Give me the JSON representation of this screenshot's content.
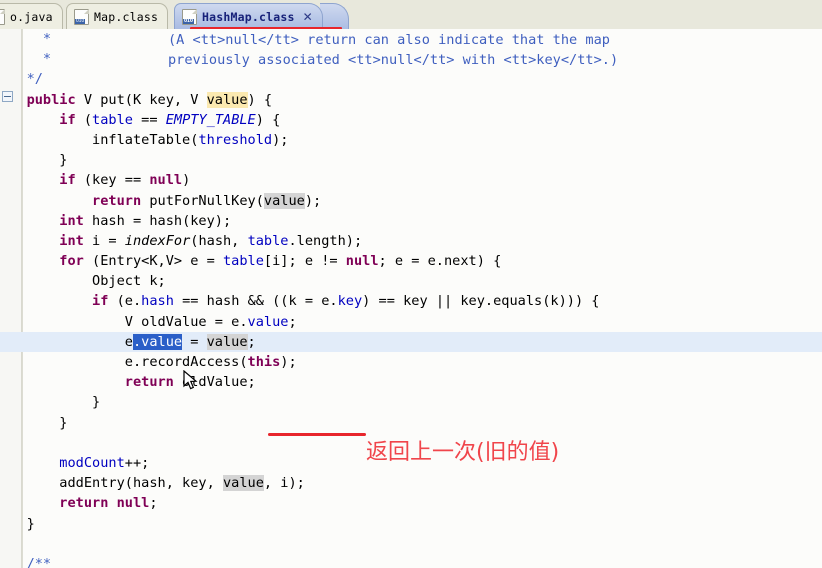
{
  "window": {
    "app": "eclipse-java-editor"
  },
  "tabs": [
    {
      "label": "o.java",
      "icon": "java-file-icon",
      "active": false,
      "closable": false
    },
    {
      "label": "Map.class",
      "icon": "class-file-icon",
      "active": false,
      "closable": false
    },
    {
      "label": "HashMap.class",
      "icon": "class-file-icon",
      "active": true,
      "closable": true,
      "close_glyph": "✕"
    }
  ],
  "icons": {
    "class_bits": "010",
    "fold_marker": "fold-collapse-icon"
  },
  "colors": {
    "annotation_red": "#e8262c",
    "annotation_text": "#f0454b",
    "selection_blue": "#2b5fc8",
    "occurrence_gray": "#d4d4d4",
    "occurrence_write": "#fbe9b0",
    "current_line": "#e2ecf9",
    "keyword": "#7f0055",
    "comment": "#3f5fbf",
    "field": "#0000c0",
    "tab_active": "#b9c8e8"
  },
  "annotation": {
    "text": "返回上一次(旧的值)"
  },
  "editor": {
    "selected_text": ".value",
    "highlighted_occurrence": "value",
    "lines": [
      {
        "indent": 5,
        "segments": [
          {
            "t": "*",
            "c": "cm"
          }
        ]
      },
      {
        "indent": 5,
        "segments": [
          {
            "t": "*",
            "c": "cm"
          }
        ]
      },
      {
        "indent": 3,
        "segments": [
          {
            "t": "*/",
            "c": "cm"
          }
        ]
      },
      {
        "indent": 3,
        "segments": [
          {
            "t": "public",
            "c": "kw"
          },
          {
            "t": " V put(K key, V ",
            "c": "pln"
          },
          {
            "t": "value",
            "c": "occw"
          },
          {
            "t": ") {",
            "c": "pln"
          }
        ]
      },
      {
        "indent": 7,
        "segments": [
          {
            "t": "if",
            "c": "kw"
          },
          {
            "t": " (",
            "c": "pln"
          },
          {
            "t": "table",
            "c": "fld"
          },
          {
            "t": " == ",
            "c": "pln"
          },
          {
            "t": "EMPTY_TABLE",
            "c": "sfld"
          },
          {
            "t": ") {",
            "c": "pln"
          }
        ]
      },
      {
        "indent": 11,
        "segments": [
          {
            "t": "inflateTable(",
            "c": "pln"
          },
          {
            "t": "threshold",
            "c": "fld"
          },
          {
            "t": ");",
            "c": "pln"
          }
        ]
      },
      {
        "indent": 7,
        "segments": [
          {
            "t": "}",
            "c": "pln"
          }
        ]
      },
      {
        "indent": 7,
        "segments": [
          {
            "t": "if",
            "c": "kw"
          },
          {
            "t": " (key == ",
            "c": "pln"
          },
          {
            "t": "null",
            "c": "kw"
          },
          {
            "t": ")",
            "c": "pln"
          }
        ]
      },
      {
        "indent": 11,
        "segments": [
          {
            "t": "return",
            "c": "kw"
          },
          {
            "t": " putForNullKey(",
            "c": "pln"
          },
          {
            "t": "value",
            "c": "occ"
          },
          {
            "t": ");",
            "c": "pln"
          }
        ]
      },
      {
        "indent": 7,
        "segments": [
          {
            "t": "int",
            "c": "kw"
          },
          {
            "t": " hash = hash(key);",
            "c": "pln"
          }
        ]
      },
      {
        "indent": 7,
        "segments": [
          {
            "t": "int",
            "c": "kw"
          },
          {
            "t": " i = ",
            "c": "pln"
          },
          {
            "t": "indexFor",
            "c": "smeth"
          },
          {
            "t": "(hash, ",
            "c": "pln"
          },
          {
            "t": "table",
            "c": "fld"
          },
          {
            "t": ".length);",
            "c": "pln"
          }
        ]
      },
      {
        "indent": 7,
        "segments": [
          {
            "t": "for",
            "c": "kw"
          },
          {
            "t": " (Entry<K,V> e = ",
            "c": "pln"
          },
          {
            "t": "table",
            "c": "fld"
          },
          {
            "t": "[i]; e != ",
            "c": "pln"
          },
          {
            "t": "null",
            "c": "kw"
          },
          {
            "t": "; e = e.next) {",
            "c": "pln"
          }
        ]
      },
      {
        "indent": 11,
        "segments": [
          {
            "t": "Object k;",
            "c": "pln"
          }
        ]
      },
      {
        "indent": 11,
        "segments": [
          {
            "t": "if",
            "c": "kw"
          },
          {
            "t": " (e.",
            "c": "pln"
          },
          {
            "t": "hash",
            "c": "fld"
          },
          {
            "t": " == hash && ((k = e.",
            "c": "pln"
          },
          {
            "t": "key",
            "c": "fld"
          },
          {
            "t": ") == key || key.equals(k))) {",
            "c": "pln"
          }
        ]
      },
      {
        "indent": 15,
        "segments": [
          {
            "t": "V oldValue = e.",
            "c": "pln"
          },
          {
            "t": "value",
            "c": "fld"
          },
          {
            "t": ";",
            "c": "pln"
          }
        ]
      },
      {
        "indent": 15,
        "segments": [
          {
            "t": "e",
            "c": "pln"
          },
          {
            "t": ".value",
            "c": "sel"
          },
          {
            "t": " = ",
            "c": "pln"
          },
          {
            "t": "value",
            "c": "occ"
          },
          {
            "t": ";",
            "c": "pln"
          }
        ],
        "current": true
      },
      {
        "indent": 15,
        "segments": [
          {
            "t": "e.recordAccess(",
            "c": "pln"
          },
          {
            "t": "this",
            "c": "kw"
          },
          {
            "t": ");",
            "c": "pln"
          }
        ]
      },
      {
        "indent": 15,
        "segments": [
          {
            "t": "return",
            "c": "kw"
          },
          {
            "t": " oldValue;",
            "c": "pln"
          }
        ]
      },
      {
        "indent": 11,
        "segments": [
          {
            "t": "}",
            "c": "pln"
          }
        ]
      },
      {
        "indent": 7,
        "segments": [
          {
            "t": "}",
            "c": "pln"
          }
        ]
      },
      {
        "indent": 0,
        "segments": [
          {
            "t": "",
            "c": "pln"
          }
        ]
      },
      {
        "indent": 7,
        "segments": [
          {
            "t": "modCount",
            "c": "fld"
          },
          {
            "t": "++;",
            "c": "pln"
          }
        ]
      },
      {
        "indent": 7,
        "segments": [
          {
            "t": "addEntry(hash, key, ",
            "c": "pln"
          },
          {
            "t": "value",
            "c": "occ"
          },
          {
            "t": ", i);",
            "c": "pln"
          }
        ]
      },
      {
        "indent": 7,
        "segments": [
          {
            "t": "return",
            "c": "kw"
          },
          {
            "t": " ",
            "c": "pln"
          },
          {
            "t": "null",
            "c": "kw"
          },
          {
            "t": ";",
            "c": "pln"
          }
        ]
      },
      {
        "indent": 3,
        "segments": [
          {
            "t": "}",
            "c": "pln"
          }
        ]
      },
      {
        "indent": 0,
        "segments": [
          {
            "t": "",
            "c": "pln"
          }
        ]
      },
      {
        "indent": 3,
        "segments": [
          {
            "t": "/**",
            "c": "cm"
          }
        ]
      }
    ],
    "javadoc": {
      "line1": "(A <tt>null</tt> return can also indicate that the map",
      "line2": "previously associated <tt>null</tt> with <tt>key</tt>.)"
    }
  }
}
